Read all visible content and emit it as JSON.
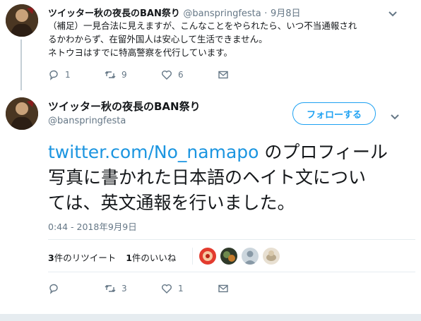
{
  "reply_tweet": {
    "name": "ツイッター秋の夜長のBAN祭り",
    "handle": "@banspringfesta",
    "separator": "·",
    "date": "9月8日",
    "text_lines": [
      "（補足）一見合法に見えますが、こんなことをやられたら、いつ不当通報され",
      "るかわからず、在留外国人は安心して生活できません。",
      "ネトウヨはすでに特高警察を代行しています。"
    ],
    "reply_count": "1",
    "retweet_count": "9",
    "like_count": "6"
  },
  "main_tweet": {
    "name": "ツイッター秋の夜長のBAN祭り",
    "handle": "@banspringfesta",
    "follow_label": "フォローする",
    "link_text": "twitter.com/No_namapo",
    "line1_rest": " のプロフィール",
    "line2": "写真に書かれた日本語のヘイト文につい",
    "line3": "ては、英文通報を行いました。",
    "timestamp": "0:44 - 2018年9月9日",
    "retweets_num": "3",
    "retweets_label": "件のリツイート",
    "likes_num": "1",
    "likes_label": "件のいいね",
    "reply_count": "",
    "retweet_count": "3",
    "like_count": "1"
  },
  "icons": [
    "reply-icon",
    "retweet-icon",
    "like-icon",
    "message-icon",
    "chevron-down-icon"
  ],
  "colors": {
    "accent": "#1da1f2",
    "link": "#1b95e0",
    "muted": "#657786",
    "thread": "#c4cfd6"
  }
}
